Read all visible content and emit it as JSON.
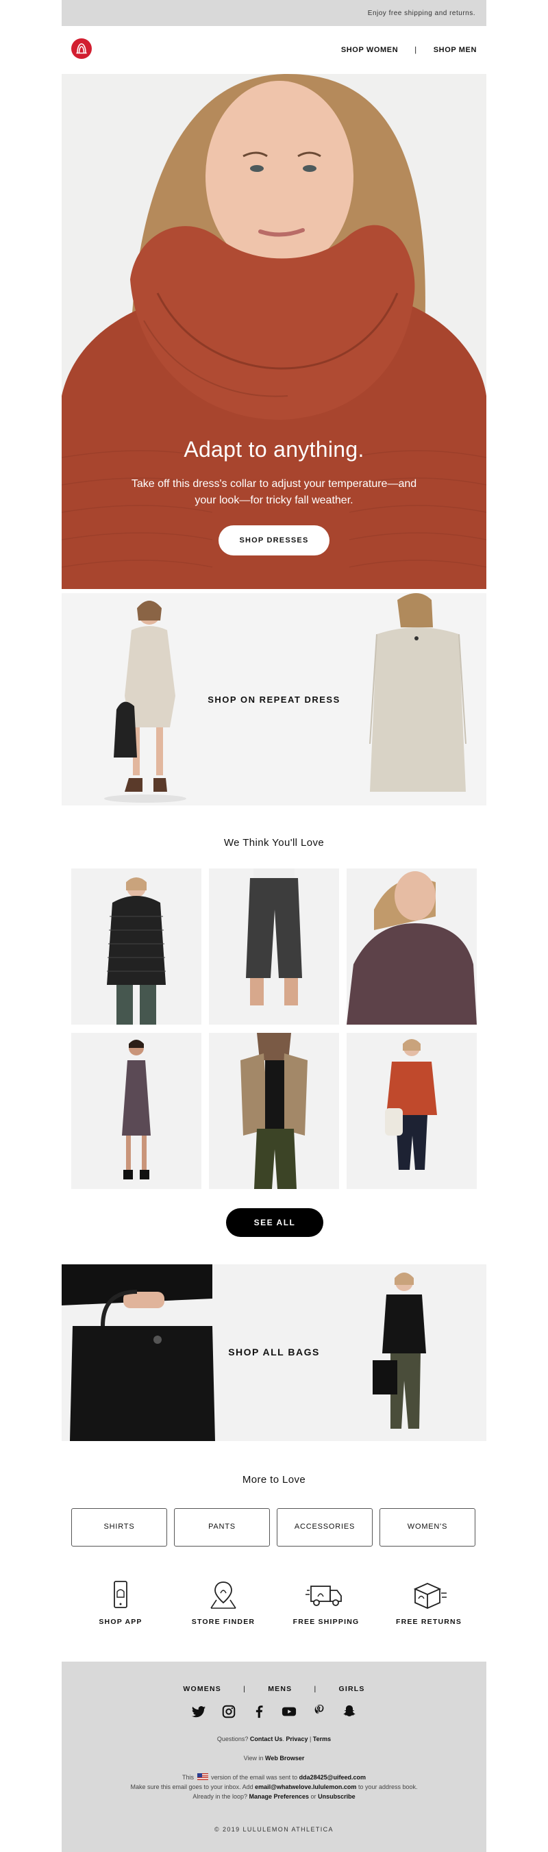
{
  "topbar": {
    "text": "Enjoy free shipping and returns."
  },
  "header": {
    "nav": {
      "women": "SHOP WOMEN",
      "separator": "|",
      "men": "SHOP MEN"
    }
  },
  "hero": {
    "heading": "Adapt to anything.",
    "body": "Take off this dress's collar to adjust your temperature—and your look—for tricky fall weather.",
    "cta": "SHOP DRESSES"
  },
  "dress_banner": {
    "label": "SHOP ON REPEAT DRESS"
  },
  "recommend": {
    "title": "We Think You'll Love",
    "cta": "SEE ALL"
  },
  "bags_banner": {
    "label": "SHOP ALL BAGS"
  },
  "more": {
    "title": "More to Love",
    "categories": [
      "SHIRTS",
      "PANTS",
      "ACCESSORIES",
      "WOMEN'S"
    ]
  },
  "features": [
    {
      "label": "SHOP APP",
      "icon": "phone-icon"
    },
    {
      "label": "STORE FINDER",
      "icon": "store-pin-icon"
    },
    {
      "label": "FREE SHIPPING",
      "icon": "truck-icon"
    },
    {
      "label": "FREE RETURNS",
      "icon": "box-icon"
    }
  ],
  "footer": {
    "nav": {
      "womens": "WOMENS",
      "mens": "MENS",
      "girls": "GIRLS",
      "separator": "|"
    },
    "social": [
      "twitter-icon",
      "instagram-icon",
      "facebook-icon",
      "youtube-icon",
      "pinterest-icon",
      "snapchat-icon"
    ],
    "questions_prefix": "Questions?",
    "contact": "Contact Us",
    "privacy": "Privacy",
    "terms": "Terms",
    "view_prefix": "View in",
    "web_browser": "Web Browser",
    "sent_prefix": "This",
    "sent_middle": "version of the email was sent to",
    "email": "dda28425@uifeed.com",
    "inbox_prefix": "Make sure this email goes to your inbox. Add",
    "sender_email": "email@whatwelove.lululemon.com",
    "inbox_suffix": "to your address book.",
    "loop_prefix": "Already in the loop?",
    "manage": "Manage Preferences",
    "or": "or",
    "unsubscribe": "Unsubscribe",
    "copyright": "© 2019 LULULEMON ATHLETICA"
  },
  "colors": {
    "brand_red": "#d21e30",
    "sweater": "#a8452e",
    "gray_bar": "#d9d9d9"
  }
}
